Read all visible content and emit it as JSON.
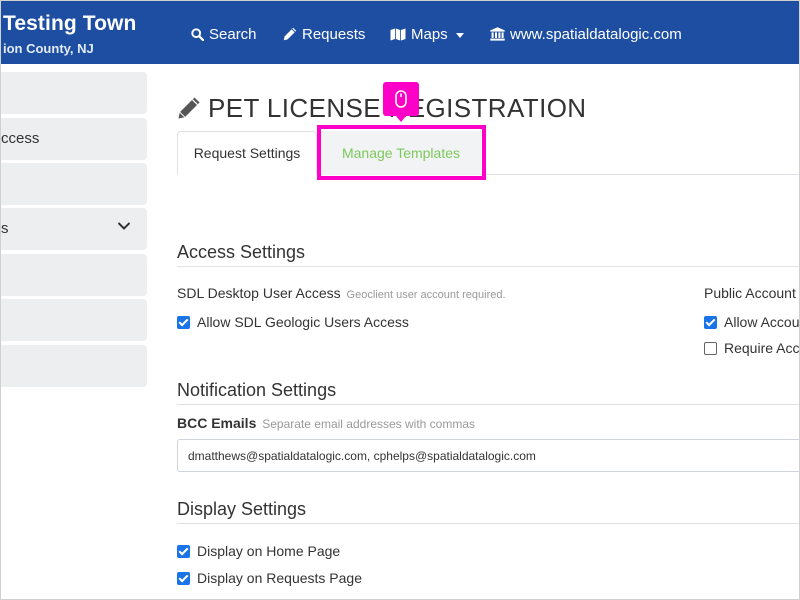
{
  "app": {
    "title": "Testing Town",
    "subtitle": "ion County, NJ"
  },
  "nav": {
    "search": "Search",
    "requests": "Requests",
    "maps": "Maps",
    "website": "www.spatialdatalogic.com"
  },
  "sidebar": {
    "items": [
      {
        "label": ""
      },
      {
        "label": "ccess"
      },
      {
        "label": ""
      },
      {
        "label": "s"
      },
      {
        "label": ""
      },
      {
        "label": ""
      },
      {
        "label": ""
      }
    ]
  },
  "page": {
    "title": "PET LICENSE REGISTRATION"
  },
  "tabs": {
    "request_settings": "Request Settings",
    "manage_templates": "Manage Templates"
  },
  "access_settings": {
    "title": "Access Settings",
    "desktop_label": "SDL Desktop User Access",
    "desktop_hint": "Geoclient user account required.",
    "allow_geologic": "Allow SDL Geologic Users Access",
    "allow_geologic_checked": true,
    "public_label": "Public Account",
    "allow_public": "Allow Accou",
    "allow_public_checked": true,
    "require_public": "Require Acc",
    "require_public_checked": false
  },
  "notification_settings": {
    "title": "Notification Settings",
    "bcc_label": "BCC Emails",
    "bcc_hint": "Separate email addresses with commas",
    "bcc_value": "dmatthews@spatialdatalogic.com, cphelps@spatialdatalogic.com"
  },
  "display_settings": {
    "title": "Display Settings",
    "home_page": "Display on Home Page",
    "home_page_checked": true,
    "requests_page": "Display on Requests Page",
    "requests_page_checked": true
  },
  "colors": {
    "navbar": "#1d4ea2",
    "highlight": "#ff00c8",
    "tab_link": "#7cc95a",
    "checkbox": "#1a73e8"
  },
  "icons": {
    "search": "search-icon",
    "requests": "pencil-icon",
    "maps": "map-icon",
    "website": "bank-icon",
    "title": "pencil-icon",
    "cursor": "mouse-icon",
    "chevron": "chevron-down-icon"
  }
}
